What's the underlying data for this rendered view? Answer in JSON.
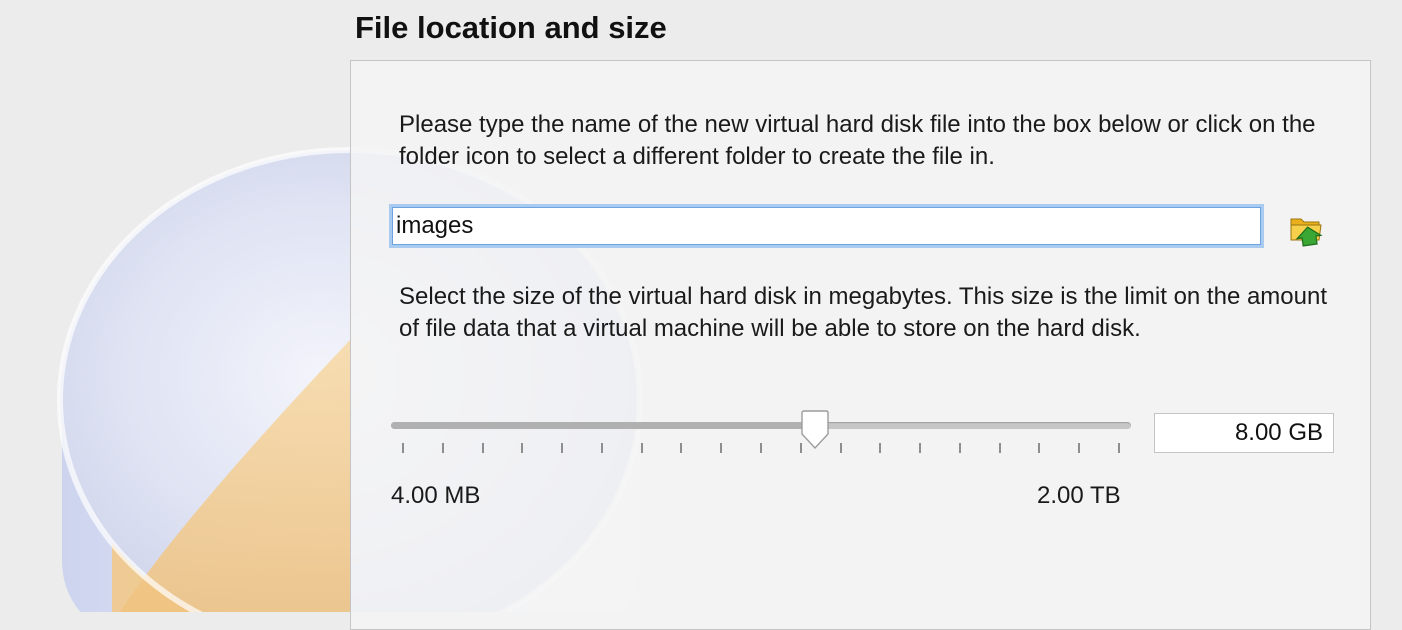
{
  "section": {
    "title": "File location and size"
  },
  "location": {
    "description": "Please type the name of the new virtual hard disk file into the box below or click on the folder icon to select a different folder to create the file in.",
    "file_name": "images",
    "folder_icon": "folder-up-icon"
  },
  "size": {
    "description": "Select the size of the virtual hard disk in megabytes. This size is the limit on the amount of file data that a virtual machine will be able to store on the hard disk.",
    "value_text": "8.00 GB",
    "min_label": "4.00 MB",
    "max_label": "2.00 TB",
    "slider_fraction": 0.575,
    "tick_count": 19
  },
  "colors": {
    "background": "#ececec",
    "focus_ring": "#a9cbf0",
    "folder_yellow": "#f2c232",
    "arrow_green": "#3aa634"
  }
}
